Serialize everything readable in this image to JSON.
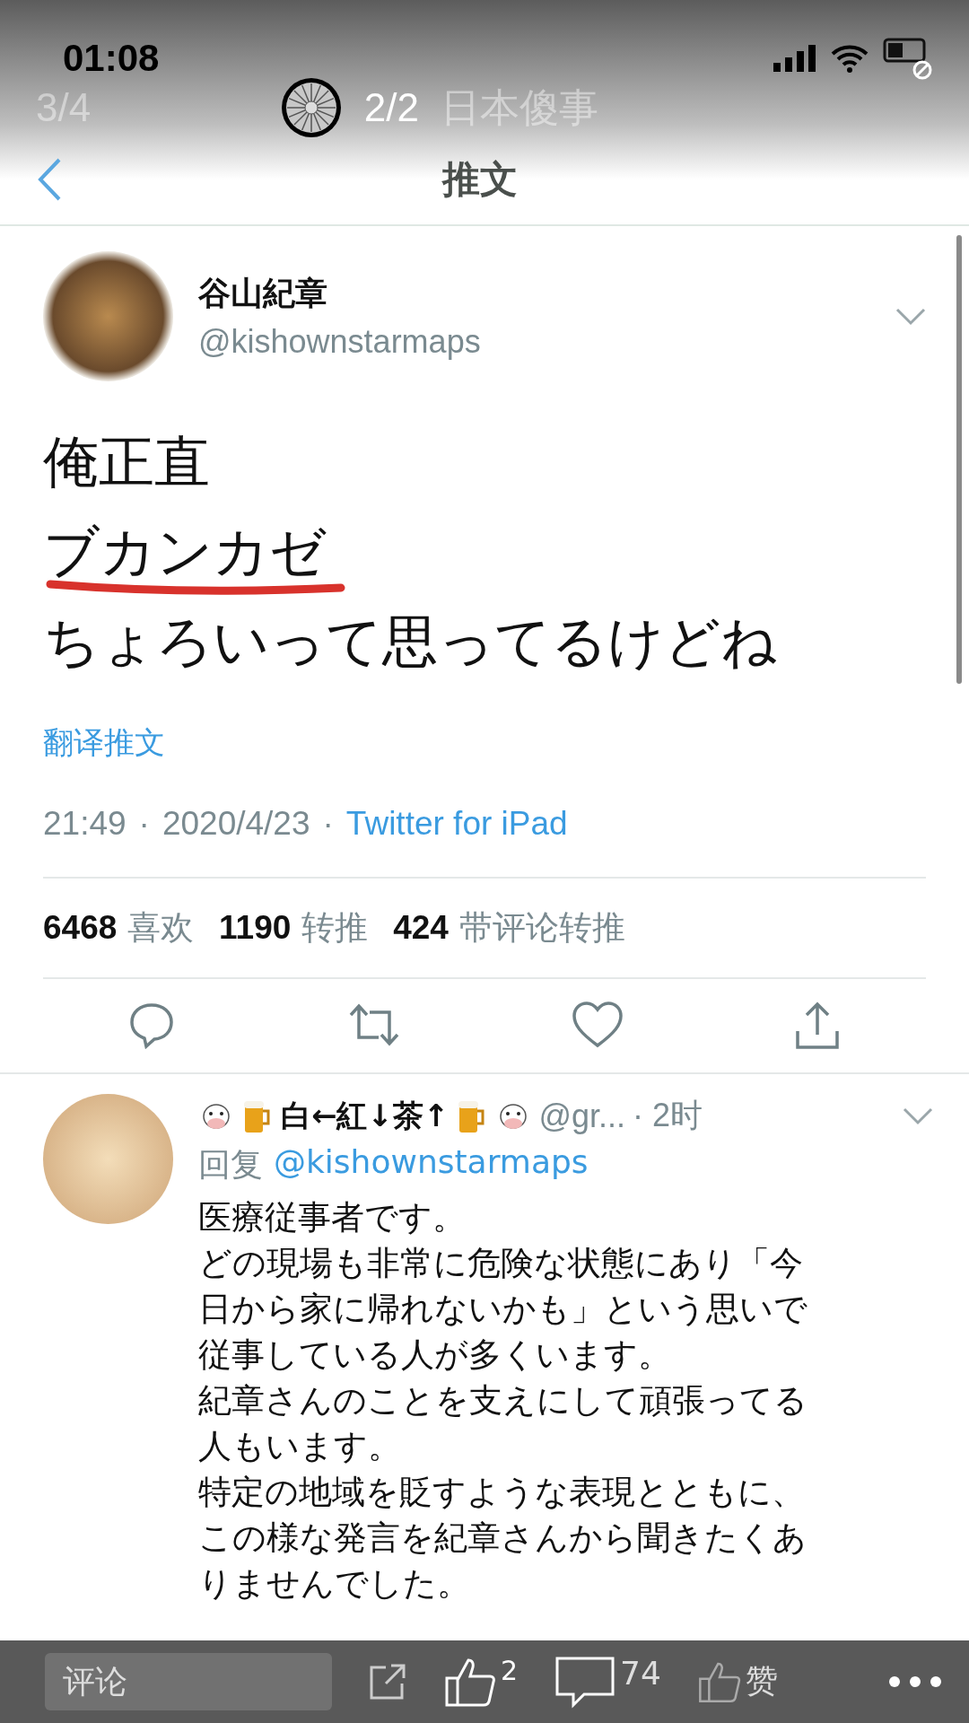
{
  "status_bar": {
    "time": "01:08"
  },
  "viewer": {
    "page_counter": "3/4",
    "image_counter": "2/2",
    "album_title": "日本傻事"
  },
  "nav": {
    "title": "推文"
  },
  "tweet": {
    "author": "谷山紀章",
    "handle": "@kishownstarmaps",
    "lines": [
      {
        "text": "俺正直",
        "underlined": false
      },
      {
        "text": "ブカンカゼ",
        "underlined": true
      },
      {
        "text": "ちょろいって思ってるけどね",
        "underlined": false
      }
    ],
    "translate": "翻译推文",
    "separator": "·",
    "time": "21:49",
    "date": "2020/4/23",
    "source": "Twitter for iPad",
    "stats": [
      {
        "count": "6468",
        "label": "喜欢"
      },
      {
        "count": "1190",
        "label": "转推"
      },
      {
        "count": "424",
        "label": "带评论转推"
      }
    ]
  },
  "reply": {
    "name": "白←紅↓茶↑",
    "handle": "@gr...",
    "age": "· 2时",
    "reply_to_label": "回复",
    "reply_to": "@kishownstarmaps",
    "lines": [
      "医療従事者です。",
      "どの現場も非常に危険な状態にあり「今",
      "日から家に帰れないかも」という思いで",
      "従事している人が多くいます。",
      "紀章さんのことを支えにして頑張ってる",
      "人もいます。",
      "特定の地域を貶すような表現とともに、",
      "この様な発言を紀章さんから聞きたくあ",
      "りませんでした。"
    ]
  },
  "bottom_bar": {
    "comment_placeholder": "评论",
    "like_count": "2",
    "comment_count": "74",
    "praise_label": "赞"
  }
}
